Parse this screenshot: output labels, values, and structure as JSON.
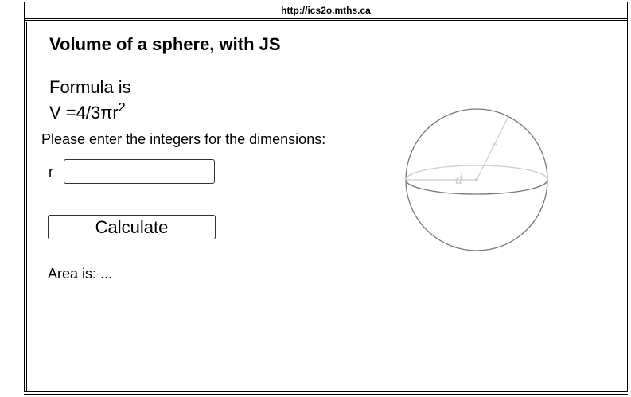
{
  "browser": {
    "url": "http://ics2o.mths.ca"
  },
  "page": {
    "title": "Volume of a sphere, with JS",
    "formula_label": "Formula is",
    "formula_text": "V =4/3πr",
    "formula_exponent": "2",
    "instructions": "Please enter the integers for the dimensions:",
    "radius_label": "r",
    "radius_value": "",
    "radius_placeholder": "",
    "calculate_label": "Calculate",
    "result_text": "Area is: ..."
  },
  "diagram": {
    "radius_symbol": "r",
    "diameter_symbol": "d",
    "stroke_color": "#777777",
    "light_color": "#cccccc"
  }
}
